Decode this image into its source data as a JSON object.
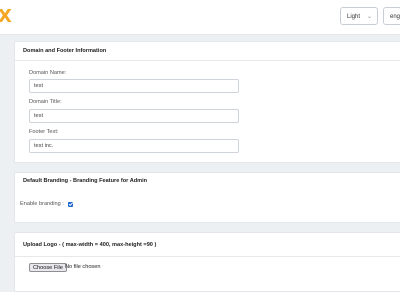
{
  "topbar": {
    "logo": "X",
    "theme_value": "Light",
    "lang_value": "eng"
  },
  "domain_card": {
    "title": "Domain and Footer Information",
    "domain_name_label": "Domain Name:",
    "domain_name_value": "test",
    "domain_title_label": "Domain Title:",
    "domain_title_value": "test",
    "footer_text_label": "Footer Text:",
    "footer_text_value": "test inc."
  },
  "branding_card": {
    "title": "Default Branding - Branding Feature for Admin",
    "enable_label": "Enable branding :",
    "enabled": true
  },
  "logo_card": {
    "title": "Upload Logo - ( max-width = 400, max-height =90 )",
    "choose_file_label": "Choose File",
    "file_status": "No file chosen"
  }
}
